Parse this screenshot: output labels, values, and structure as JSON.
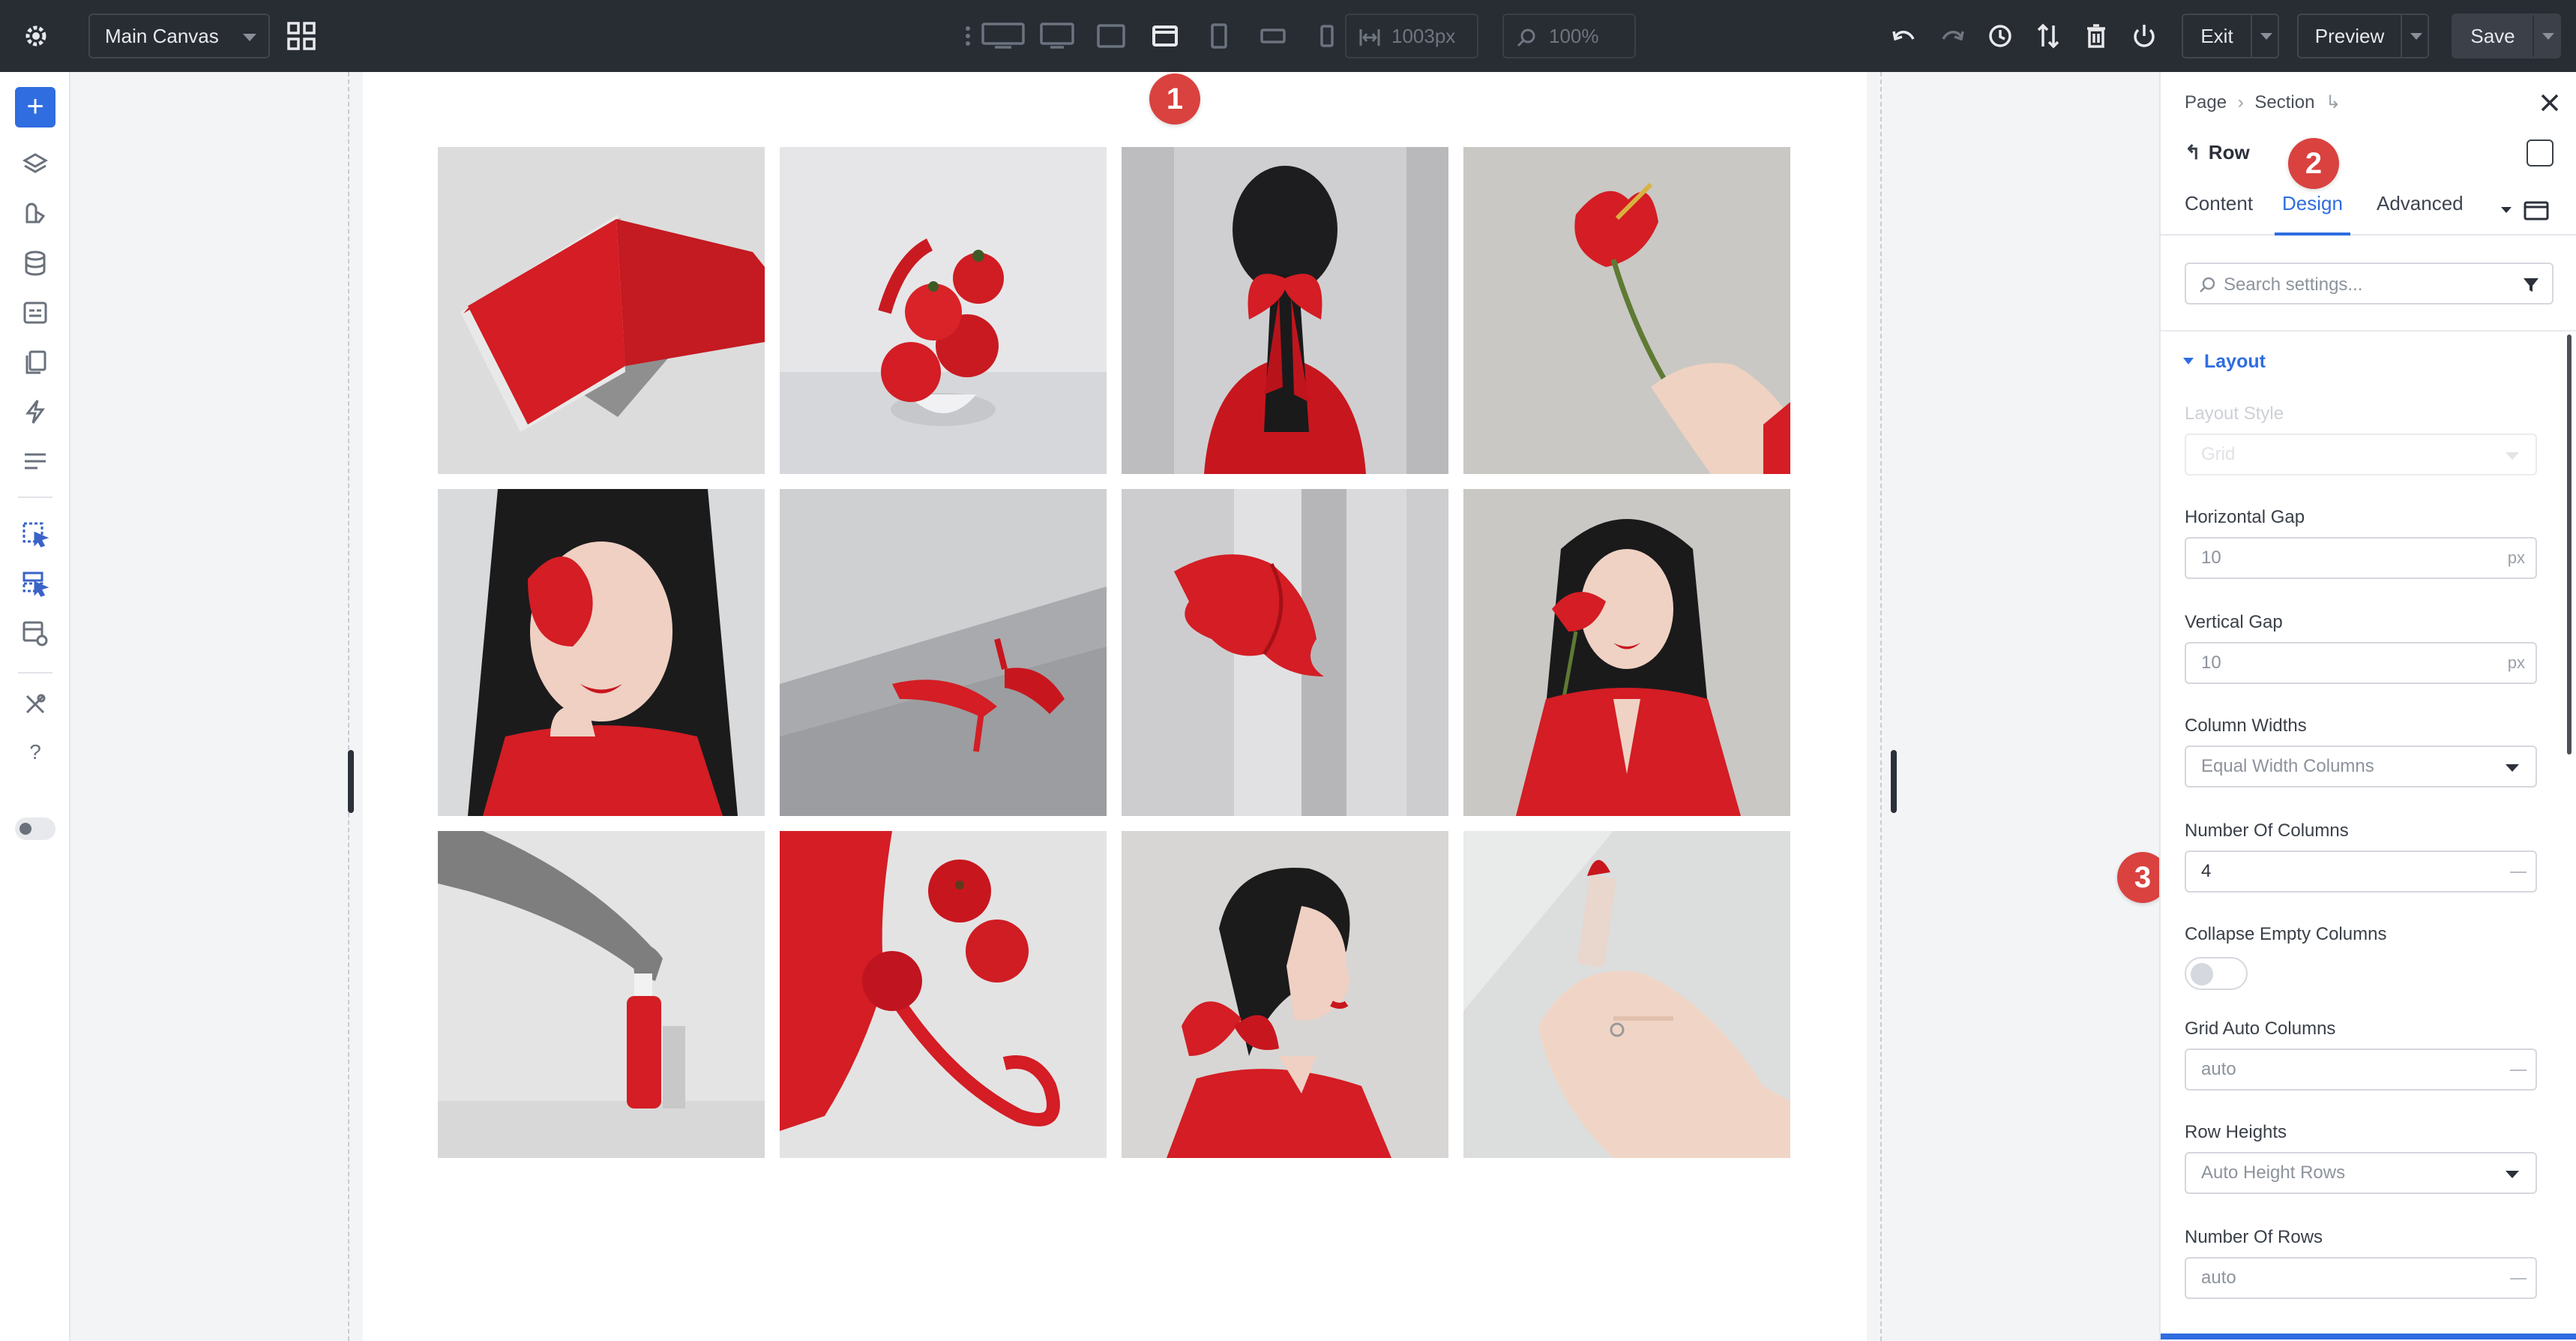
{
  "topbar": {
    "canvas_name": "Main Canvas",
    "width_value": "1003px",
    "zoom_value": "100%",
    "exit_label": "Exit",
    "preview_label": "Preview",
    "save_label": "Save"
  },
  "device_views": [
    "desktop-wide",
    "desktop",
    "tablet-landscape",
    "tablet",
    "tablet-portrait",
    "phone-landscape",
    "phone"
  ],
  "left_toolbar": {
    "add_label": "+",
    "icons": [
      "layers-icon",
      "theme-builder-icon",
      "database-icon",
      "portability-icon",
      "pages-icon",
      "lightning-icon",
      "presets-icon",
      "select-module-icon",
      "select-row-icon",
      "layout-settings-icon",
      "tools-icon",
      "help-icon"
    ],
    "help_label": "?"
  },
  "canvas": {
    "tiles": [
      "red-book-icon",
      "tomatoes-icon",
      "ribbon-hair-icon",
      "anthurium-hand-icon",
      "woman-flower-eye-icon",
      "red-heels-icon",
      "flying-scarf-icon",
      "woman-flower-holding-icon",
      "red-bottle-icon",
      "red-bag-apples-icon",
      "woman-profile-icon",
      "lipstick-hand-icon"
    ],
    "annotations": [
      "1",
      "2",
      "3"
    ]
  },
  "panel": {
    "breadcrumb": [
      "Page",
      "Section"
    ],
    "element_title": "Row",
    "tabs": [
      "Content",
      "Design",
      "Advanced"
    ],
    "active_tab": "Design",
    "search_placeholder": "Search settings...",
    "section_title": "Layout",
    "fields": {
      "layout_style": {
        "label": "Layout Style",
        "value": "Grid"
      },
      "horizontal_gap": {
        "label": "Horizontal Gap",
        "value": "10",
        "unit": "px"
      },
      "vertical_gap": {
        "label": "Vertical Gap",
        "value": "10",
        "unit": "px"
      },
      "column_widths": {
        "label": "Column Widths",
        "value": "Equal Width Columns"
      },
      "number_of_columns": {
        "label": "Number Of Columns",
        "value": "4"
      },
      "collapse_empty_columns": {
        "label": "Collapse Empty Columns",
        "on": false
      },
      "grid_auto_columns": {
        "label": "Grid Auto Columns",
        "value": "auto"
      },
      "row_heights": {
        "label": "Row Heights",
        "value": "Auto Height Rows"
      },
      "number_of_rows": {
        "label": "Number Of Rows",
        "value": "auto"
      }
    }
  },
  "colors": {
    "accent": "#2f6de1",
    "topbar_bg": "#282c33",
    "badge": "#d9423f",
    "photo_red": "#d41d24"
  }
}
